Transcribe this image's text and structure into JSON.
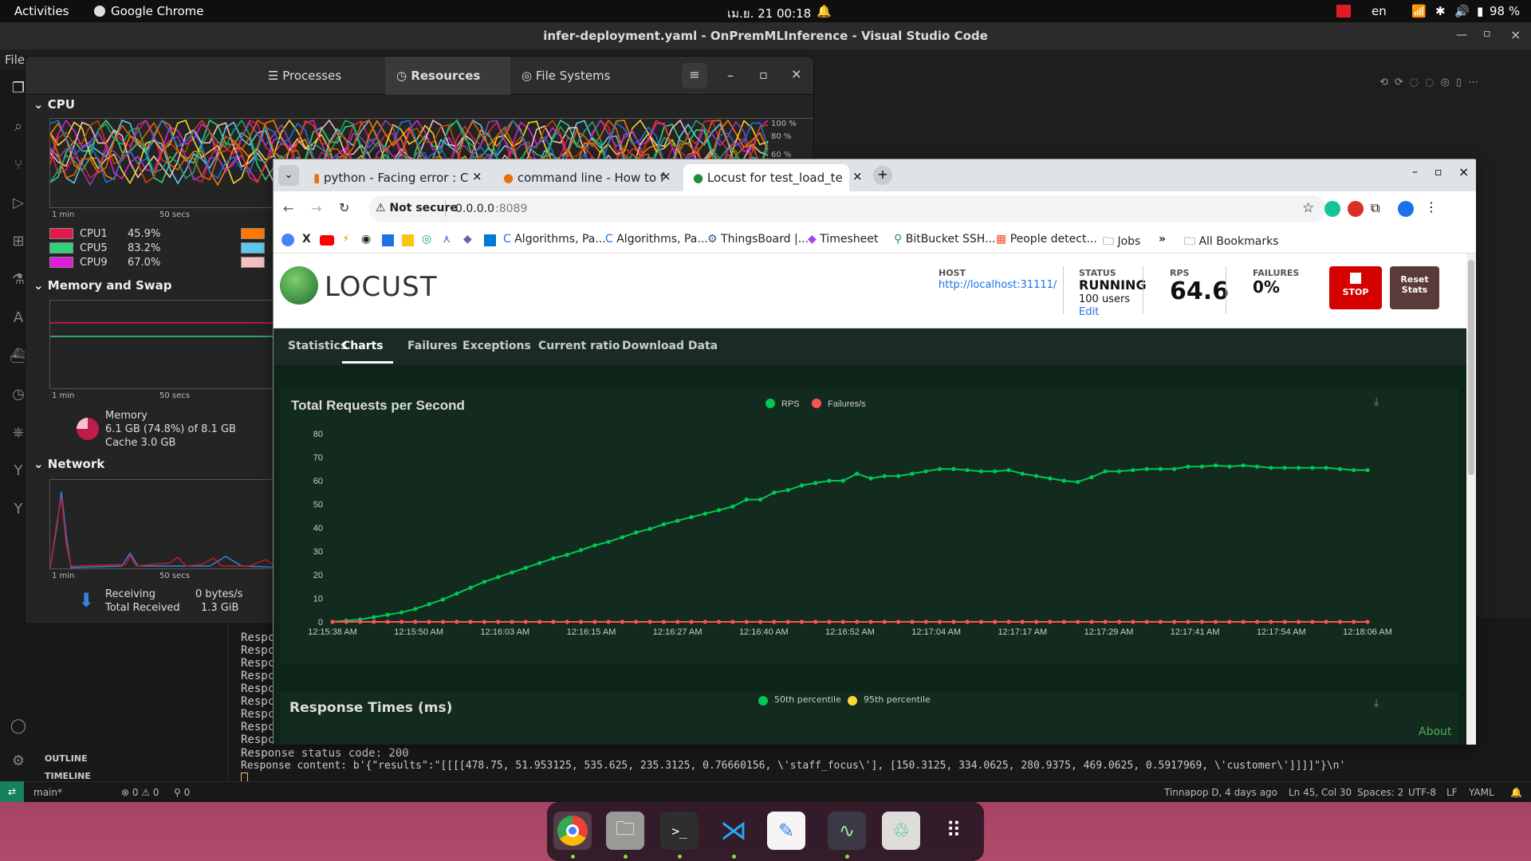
{
  "topbar": {
    "activities": "Activities",
    "app": "Google Chrome",
    "clock": "เม.ย. 21  00:18",
    "lang": "en",
    "battery": "98 %"
  },
  "vscode": {
    "title": "infer-deployment.yaml - OnPremMLInference - Visual Studio Code",
    "menu_file": "File",
    "sidebar": {
      "outline": "OUTLINE",
      "timeline": "TIMELINE"
    },
    "terminal": {
      "lines": [
        "Respc",
        "Respc",
        "Respc",
        "Respc",
        "Respc",
        "Respc",
        "Respc",
        "Respc",
        "Respc"
      ],
      "status_line": "Response status code: 200",
      "content_line": "Response content: b'{\"results\":\"[[[[478.75, 51.953125, 535.625, 235.3125, 0.76660156, \\'staff_focus\\'], [150.3125, 334.0625, 280.9375, 469.0625, 0.5917969, \\'customer\\']]]]\"}\\n'"
    },
    "status": {
      "branch": "main*",
      "problems": "⊗ 0 ⚠ 0",
      "ports": "⚲ 0",
      "blame": "Tinnapop D, 4 days ago",
      "position": "Ln 45, Col 30",
      "spaces": "Spaces: 2",
      "encoding": "UTF-8",
      "eol": "LF",
      "lang": "YAML"
    }
  },
  "sysmon": {
    "tabs": [
      "Processes",
      "Resources",
      "File Systems"
    ],
    "cpu": {
      "title": "CPU",
      "axis": [
        "100 %",
        "80 %",
        "60 %"
      ],
      "time": [
        "1 min",
        "50 secs"
      ],
      "legend": [
        {
          "name": "CPU1",
          "value": "45.9%",
          "color": "#e01b4b"
        },
        {
          "name": "CPU5",
          "value": "83.2%",
          "color": "#33d17a"
        },
        {
          "name": "CPU9",
          "value": "67.0%",
          "color": "#e01bd9"
        }
      ]
    },
    "memory": {
      "title": "Memory and Swap",
      "time": [
        "1 min",
        "50 secs"
      ],
      "label": "Memory",
      "usage": "6.1 GB (74.8%) of 8.1 GB",
      "cache": "Cache 3.0 GB"
    },
    "network": {
      "title": "Network",
      "time": [
        "1 min",
        "50 secs"
      ],
      "receiving": "Receiving",
      "receiving_value": "0 bytes/s",
      "total": "Total Received",
      "total_value": "1.3 GiB"
    }
  },
  "chrome": {
    "tabs": [
      "python - Facing error : C",
      "command line - How to f",
      "Locust for test_load_te"
    ],
    "security": "Not secure",
    "url_host": "0.0.0.0",
    "url_port": ":8089",
    "bookmarks": [
      "Algorithms, Pa...",
      "Algorithms, Pa...",
      "ThingsBoard |...",
      "Timesheet",
      "BitBucket SSH...",
      "People detect...",
      "Jobs",
      "All Bookmarks"
    ]
  },
  "locust": {
    "logo": "LOCUST",
    "host_label": "HOST",
    "host": "http://localhost:31111/",
    "status_label": "STATUS",
    "status": "RUNNING",
    "users": "100 users",
    "edit": "Edit",
    "rps_label": "RPS",
    "rps": "64.6",
    "failures_label": "FAILURES",
    "failures": "0%",
    "stop": "STOP",
    "reset_l1": "Reset",
    "reset_l2": "Stats",
    "nav": [
      "Statistics",
      "Charts",
      "Failures",
      "Exceptions",
      "Current ratio",
      "Download Data"
    ],
    "about": "About",
    "chart2_title": "Response Times (ms)",
    "chart2_legend": [
      "50th percentile",
      "95th percentile"
    ]
  },
  "chart_data": {
    "type": "line",
    "title": "Total Requests per Second",
    "ylim": [
      0,
      80
    ],
    "yticks": [
      0,
      10,
      20,
      30,
      40,
      50,
      60,
      70,
      80
    ],
    "x_labels": [
      "12:15:38 AM",
      "12:15:50 AM",
      "12:16:03 AM",
      "12:16:15 AM",
      "12:16:27 AM",
      "12:16:40 AM",
      "12:16:52 AM",
      "12:17:04 AM",
      "12:17:17 AM",
      "12:17:29 AM",
      "12:17:41 AM",
      "12:17:54 AM",
      "12:18:06 AM"
    ],
    "series": [
      {
        "name": "RPS",
        "color": "#00c853",
        "values": [
          0,
          0.5,
          1,
          2,
          3,
          4,
          5.5,
          7.5,
          9.5,
          12,
          14.5,
          17,
          19,
          21,
          23,
          25,
          27,
          28.5,
          30.5,
          32.5,
          34,
          36,
          38,
          39.5,
          41.5,
          43,
          44.5,
          46,
          47.5,
          49,
          52,
          52,
          55,
          56,
          58,
          59,
          60,
          60,
          63,
          61,
          62,
          62,
          63,
          64,
          65,
          65,
          64.5,
          64,
          64,
          64.5,
          63,
          62,
          61,
          60,
          59.5,
          61.5,
          64,
          64,
          64.5,
          65,
          65,
          65,
          66,
          66,
          66.5,
          66,
          66.5,
          66,
          65.5,
          65.5,
          65.5,
          65.5,
          65.5,
          65,
          64.5,
          64.5
        ]
      },
      {
        "name": "Failures/s",
        "color": "#ff5252",
        "values": [
          0,
          0,
          0,
          0,
          0,
          0,
          0,
          0,
          0,
          0,
          0,
          0,
          0,
          0,
          0,
          0,
          0,
          0,
          0,
          0,
          0,
          0,
          0,
          0,
          0,
          0,
          0,
          0,
          0,
          0,
          0,
          0,
          0,
          0,
          0,
          0,
          0,
          0,
          0,
          0,
          0,
          0,
          0,
          0,
          0,
          0,
          0,
          0,
          0,
          0,
          0,
          0,
          0,
          0,
          0,
          0,
          0,
          0,
          0,
          0,
          0,
          0,
          0,
          0,
          0,
          0,
          0,
          0,
          0,
          0,
          0,
          0,
          0,
          0,
          0,
          0
        ]
      }
    ]
  }
}
